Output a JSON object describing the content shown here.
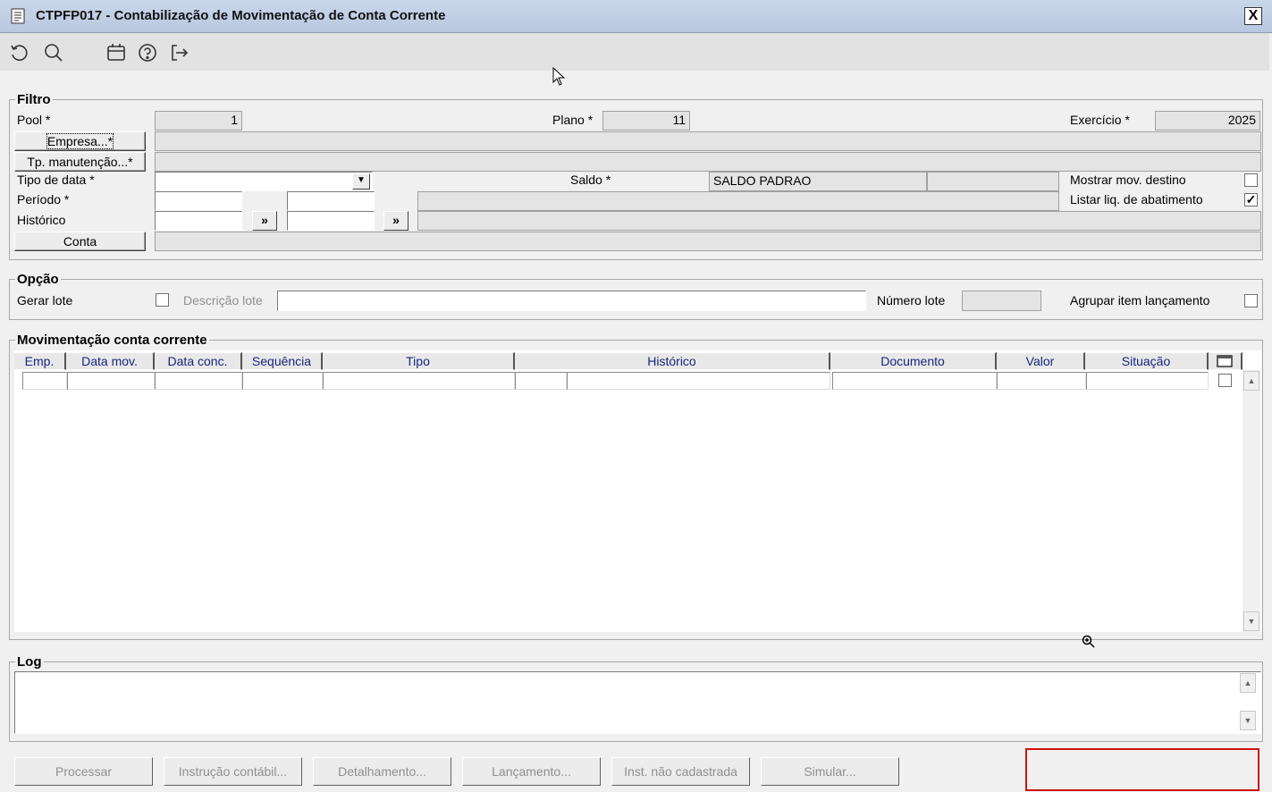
{
  "window": {
    "title": "CTPFP017 - Contabilização de Movimentação de Conta Corrente",
    "close_label": "X"
  },
  "toolbar": {
    "icons": [
      "undo-icon",
      "search-icon",
      "calendar-icon",
      "help-icon",
      "exit-icon"
    ]
  },
  "filtro": {
    "legend": "Filtro",
    "pool_label": "Pool *",
    "pool_value": "1",
    "plano_label": "Plano *",
    "plano_value": "11",
    "exercicio_label": "Exercício *",
    "exercicio_value": "2025",
    "empresa_button": "Empresa...*",
    "tp_manutencao_button": "Tp. manutenção...*",
    "tipo_data_label": "Tipo de data *",
    "tipo_data_value": "",
    "saldo_label": "Saldo *",
    "saldo_value": "SALDO PADRAO",
    "mostrar_mov_label": "Mostrar mov. destino",
    "mostrar_mov_checked": false,
    "periodo_label": "Período *",
    "listar_liq_label": "Listar liq. de abatimento",
    "listar_liq_checked": true,
    "historico_label": "Histórico",
    "arrow_label": "»",
    "conta_button": "Conta"
  },
  "opcao": {
    "legend": "Opção",
    "gerar_lote_label": "Gerar lote",
    "gerar_lote_checked": false,
    "descricao_lote_label": "Descrição lote",
    "numero_lote_label": "Número lote",
    "agrupar_label": "Agrupar item lançamento",
    "agrupar_checked": false
  },
  "movimentacao": {
    "legend": "Movimentação conta corrente",
    "columns": [
      "Emp.",
      "Data mov.",
      "Data conc.",
      "Sequência",
      "Tipo",
      "Histórico",
      "Documento",
      "Valor",
      "Situação"
    ]
  },
  "log": {
    "legend": "Log"
  },
  "buttons": {
    "processar": "Processar",
    "instrucao": "Instrução contábil...",
    "detalhamento": "Detalhamento...",
    "lancamento": "Lançamento...",
    "inst_nao_cadastrada": "Inst. não cadastrada",
    "simular": "Simular..."
  },
  "colors": {
    "titlebar": "#c9d6ea",
    "column_header_text": "#1a237e",
    "status_border": "#d01010"
  }
}
